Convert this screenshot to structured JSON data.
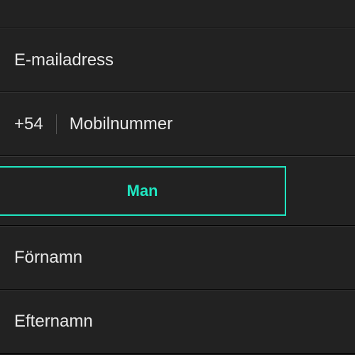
{
  "fields": {
    "top_hidden": "",
    "email_placeholder": "E-mailadress",
    "country_code": "+54",
    "mobile_placeholder": "Mobilnummer",
    "gender_selected": "Man",
    "firstname_placeholder": "Förnamn",
    "lastname_placeholder": "Efternamn"
  },
  "colors": {
    "accent": "#1fe6c1"
  }
}
